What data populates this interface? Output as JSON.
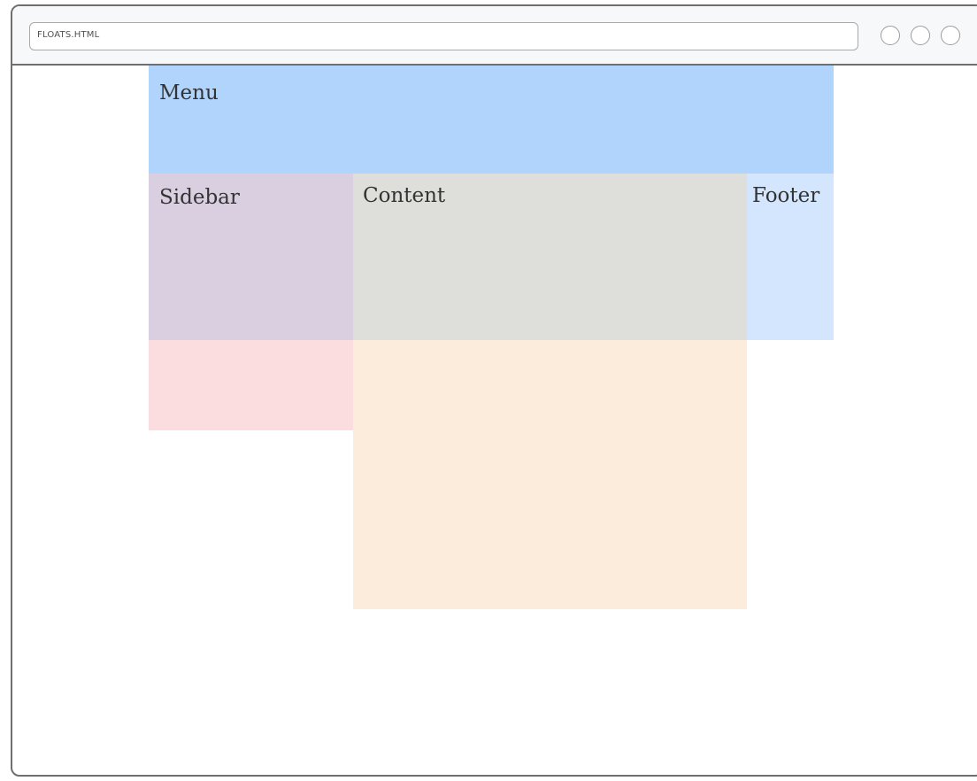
{
  "browser": {
    "address_text": "FLOATS.HTML",
    "window_buttons": [
      "circle-button",
      "circle-button",
      "circle-button"
    ]
  },
  "layout_blocks": {
    "menu": {
      "label": "Menu",
      "color": "#b0d4fb"
    },
    "sidebar": {
      "label": "Sidebar",
      "color": "#dacfe1"
    },
    "content": {
      "label": "Content",
      "color": "#dedfdb"
    },
    "footer": {
      "label": "Footer",
      "color": "#d3e6fd"
    },
    "sidebar_overflow": {
      "color": "#fbdcdf"
    },
    "content_overflow": {
      "color": "#fbecdb"
    }
  }
}
